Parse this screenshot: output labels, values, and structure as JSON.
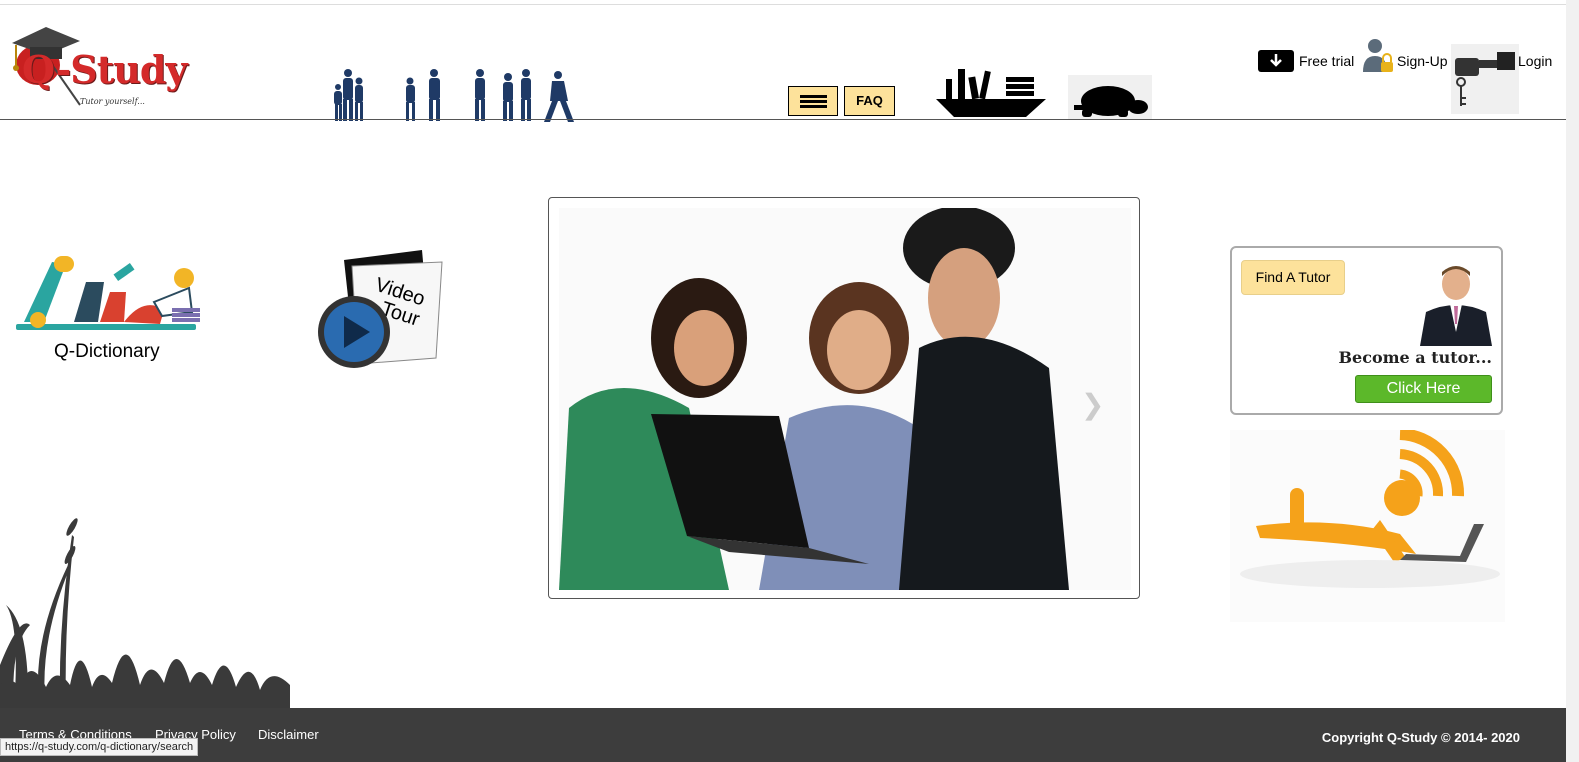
{
  "header": {
    "logo_text": "Q-Study",
    "logo_tagline": "Tutor yourself...",
    "faq_label": "FAQ",
    "free_trial_label": "Free trial",
    "signup_label": "Sign-Up",
    "login_label": "Login"
  },
  "left": {
    "q_dictionary_label": "Q-Dictionary",
    "video_tour_line1": "Video",
    "video_tour_line2": "Tour"
  },
  "tutor_box": {
    "find_tutor_label": "Find A Tutor",
    "become_tutor_text": "Become a tutor...",
    "click_here_label": "Click Here"
  },
  "footer": {
    "links": [
      "Terms & Conditions",
      "Privacy Policy",
      "Disclaimer"
    ],
    "copyright": "Copyright Q-Study © 2014- 2020"
  },
  "status_bar_url": "https://q-study.com/q-dictionary/search",
  "colors": {
    "accent_button": "#fde29b",
    "brand_red": "#d42a2a",
    "cta_green": "#5cb82a",
    "footer_bg": "#3d3d3d"
  }
}
